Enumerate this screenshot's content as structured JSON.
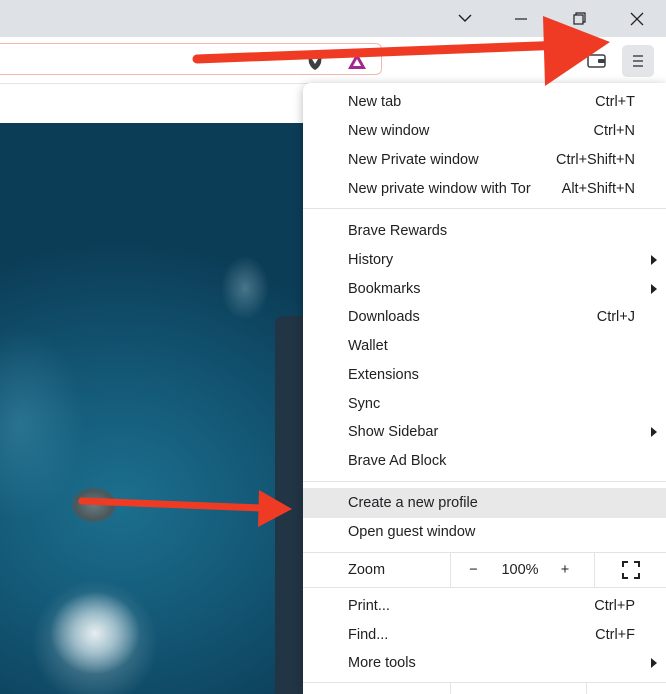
{
  "menu": {
    "groups": [
      [
        {
          "label": "New tab",
          "shortcut": "Ctrl+T"
        },
        {
          "label": "New window",
          "shortcut": "Ctrl+N"
        },
        {
          "label": "New Private window",
          "shortcut": "Ctrl+Shift+N"
        },
        {
          "label": "New private window with Tor",
          "shortcut": "Alt+Shift+N"
        }
      ],
      [
        {
          "label": "Brave Rewards",
          "shortcut": ""
        },
        {
          "label": "History",
          "shortcut": "",
          "submenu": true
        },
        {
          "label": "Bookmarks",
          "shortcut": "",
          "submenu": true
        },
        {
          "label": "Downloads",
          "shortcut": "Ctrl+J"
        },
        {
          "label": "Wallet",
          "shortcut": ""
        },
        {
          "label": "Extensions",
          "shortcut": ""
        },
        {
          "label": "Sync",
          "shortcut": ""
        },
        {
          "label": "Show Sidebar",
          "shortcut": "",
          "submenu": true
        },
        {
          "label": "Brave Ad Block",
          "shortcut": ""
        }
      ],
      [
        {
          "label": "Create a new profile",
          "shortcut": "",
          "highlighted": true
        },
        {
          "label": "Open guest window",
          "shortcut": ""
        }
      ],
      [
        {
          "label": "Print...",
          "shortcut": "Ctrl+P"
        },
        {
          "label": "Find...",
          "shortcut": "Ctrl+F"
        },
        {
          "label": "More tools",
          "shortcut": "",
          "submenu": true
        }
      ]
    ],
    "zoom": {
      "label": "Zoom",
      "minus": "−",
      "value": "100%",
      "plus": "+"
    }
  },
  "icons": {
    "titlebar": [
      "chevron-down-icon",
      "minimize-icon",
      "restore-icon",
      "close-icon"
    ],
    "toolbar": [
      "brave-shields-icon",
      "brave-rewards-icon",
      "wallet-icon",
      "hamburger-menu-icon"
    ]
  },
  "colors": {
    "annotation_arrow": "#ef3b24",
    "menu_highlight": "#e8e8e9",
    "titlebar_bg": "#dee1e6",
    "ocean": "#145a78"
  }
}
